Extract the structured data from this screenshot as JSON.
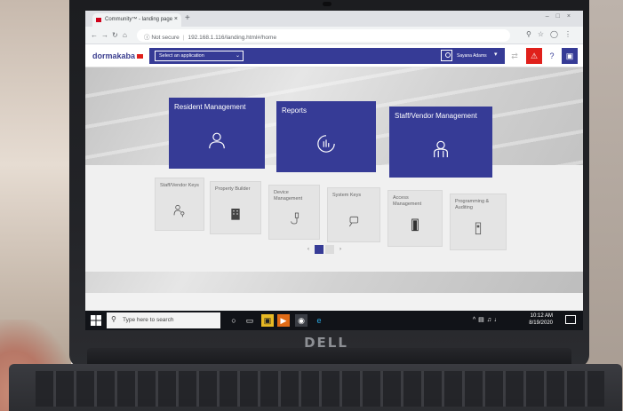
{
  "browser": {
    "tab_title": "Community™ - landing page",
    "new_tab_symbol": "+",
    "close_symbol": "×",
    "security_text": "Not secure",
    "address": "192.168.1.116/landing.html#/home"
  },
  "app": {
    "brand": "dormakaba",
    "select_placeholder": "Select an application",
    "user_name": "Sayana Adams",
    "accent_color": "#363b96",
    "alert_color": "#e0201b"
  },
  "tiles_primary": [
    {
      "label": "Resident Management",
      "icon": "person-icon"
    },
    {
      "label": "Reports",
      "icon": "report-chart-icon"
    },
    {
      "label": "Staff/Vendor Management",
      "icon": "staff-icon"
    }
  ],
  "tiles_secondary": [
    {
      "label": "Staff/Vendor Keys",
      "icon": "key-person-icon"
    },
    {
      "label": "Property Builder",
      "icon": "building-icon"
    },
    {
      "label": "Device Management",
      "icon": "device-icon"
    },
    {
      "label": "System Keys",
      "icon": "system-key-icon"
    },
    {
      "label": "Access Management",
      "icon": "door-icon"
    },
    {
      "label": "Programming & Auditing",
      "icon": "lock-device-icon"
    }
  ],
  "taskbar": {
    "search_placeholder": "Type here to search",
    "time": "10:12 AM",
    "date": "8/19/2020"
  },
  "laptop": {
    "brand": "DELL"
  }
}
